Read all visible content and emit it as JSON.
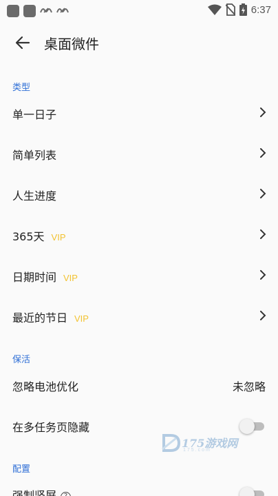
{
  "status_bar": {
    "left_icons": [
      "app-icon",
      "app-icon",
      "link-icon",
      "link-icon"
    ],
    "link_glyph": "ᔕ",
    "time": "6:37"
  },
  "app_bar": {
    "title": "桌面微件"
  },
  "sections": {
    "type": {
      "header": "类型",
      "items": [
        {
          "label": "单一日子",
          "vip": ""
        },
        {
          "label": "简单列表",
          "vip": ""
        },
        {
          "label": "人生进度",
          "vip": ""
        },
        {
          "label": "365天",
          "vip": "VIP"
        },
        {
          "label": "日期时间",
          "vip": "VIP"
        },
        {
          "label": "最近的节日",
          "vip": "VIP"
        }
      ]
    },
    "keepalive": {
      "header": "保活",
      "battery": {
        "label": "忽略电池优化",
        "value": "未忽略"
      },
      "hide": {
        "label": "在多任务页隐藏",
        "on": false
      }
    },
    "config": {
      "header": "配置",
      "portrait": {
        "label": "强制竖屏",
        "help": "?",
        "on": false
      }
    }
  },
  "watermark": {
    "text": "175游戏网",
    "sub": "175.com"
  },
  "colors": {
    "accent": "#2f6fd6",
    "vip": "#f2c230",
    "background": "#fafafa"
  }
}
